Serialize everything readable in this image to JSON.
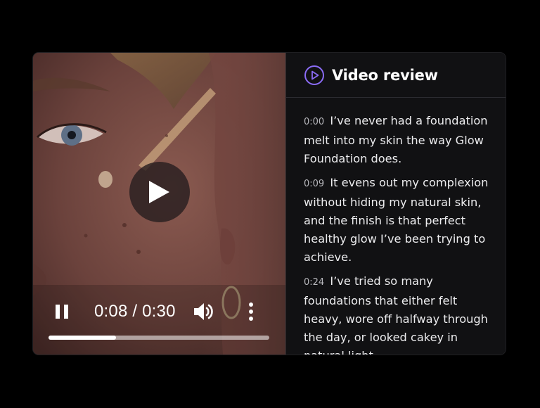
{
  "player": {
    "current_time": "0:08",
    "duration": "0:30",
    "time_display": "0:08 / 0:30",
    "progress_fraction": 0.305,
    "state": "paused",
    "icons": {
      "play": "play-icon",
      "pause": "pause-icon",
      "volume": "volume-icon",
      "more": "more-vertical-icon"
    }
  },
  "panel": {
    "title": "Video review",
    "icon": "play-circle-icon",
    "accent_color": "#8b6cf6"
  },
  "transcript": [
    {
      "time": "0:00",
      "text": "I’ve never had a foundation melt into my skin the way Glow Foundation does."
    },
    {
      "time": "0:09",
      "text": "It evens out my complexion without hiding my natural skin, and the finish is that perfect healthy glow I’ve been trying to achieve."
    },
    {
      "time": "0:24",
      "text": "I’ve tried so many foundations that either felt heavy, wore off halfway through the day, or looked cakey in natural light."
    }
  ]
}
